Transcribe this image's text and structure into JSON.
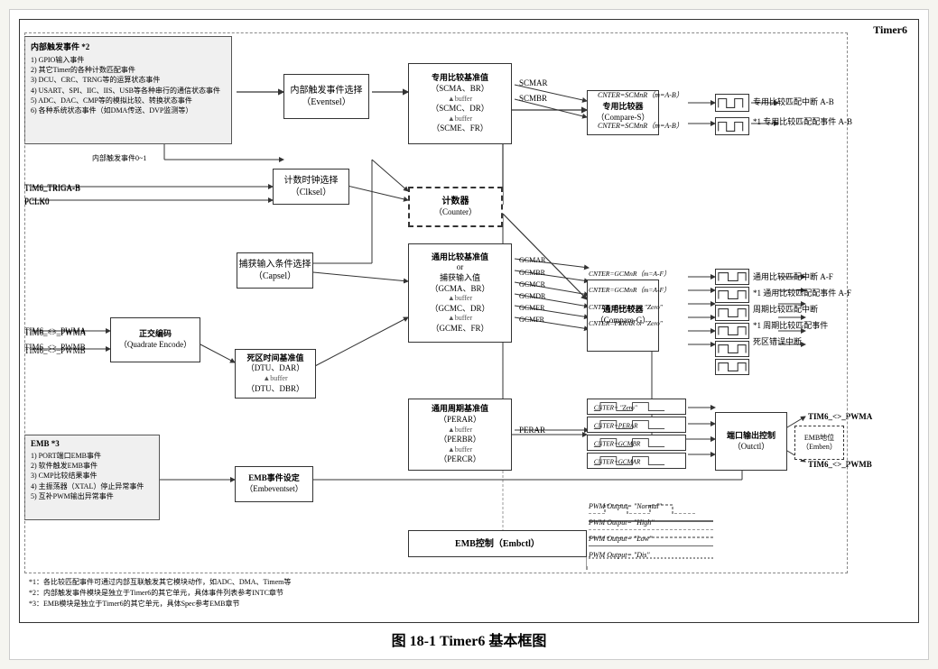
{
  "title": "Timer6",
  "caption": "图  18-1   Timer6 基本框图",
  "left_panel": {
    "header": "内部触发事件 *2",
    "items": [
      "1) GPIO输入事件",
      "2) 其它Timer的各种计数匹配事件",
      "3) DCU、CRC、TRNG等的运算状态事件",
      "4) USART、SPI、IIC、IIS、USB等各种串行的通信状态",
      "   事件",
      "5) ADC、DAC、CMP等的模拟比较、转换状态事件",
      "6) 各种系统状态事件（如DMA传送、DVP监测等）"
    ]
  },
  "emb_panel": {
    "header": "EMB *3",
    "items": [
      "1) PORT端口EMB事件",
      "2) 软件触发EMB事件",
      "3) CMP比较结果事件",
      "4) 主振荡器（XTAL）停止异常事件",
      "5) 互补PWM输出异常事件"
    ]
  },
  "boxes": {
    "eventsel": {
      "line1": "内部触发事件选择",
      "line2": "（Eventsel）"
    },
    "clksel": {
      "line1": "计数时钟选择",
      "line2": "（Clksel）"
    },
    "capsel": {
      "line1": "捕获输入条件选择",
      "line2": "（Capsel）"
    },
    "counter": {
      "line1": "计数器",
      "line2": "（Counter）"
    },
    "compare_s": {
      "line1": "专用比较器",
      "line2": "（Compare-S）"
    },
    "compare_g": {
      "line1": "通用比较器",
      "line2": "（Compare-G）"
    },
    "quadrate": {
      "line1": "正交编码",
      "line2": "（Quadrate Encode）"
    },
    "dead_ref": {
      "line1": "死区时间基准值",
      "line2": "（DTU、DAR）",
      "line3": "buffer",
      "line4": "（DTU、DBR）"
    },
    "special_ref": {
      "line1": "专用比较基准值",
      "line2": "（SCMA、BR）",
      "line3": "buffer",
      "line4": "（SCMC、DR）",
      "line5": "buffer",
      "line6": "（SCME、FR）"
    },
    "general_ref": {
      "line1": "通用比较基准值",
      "line2": "or",
      "line3": "捕获输入值",
      "line4": "（GCMA、BR）",
      "line5": "buffer",
      "line6": "（GCMC、DR）",
      "line7": "buffer",
      "line8": "（GCME、FR）"
    },
    "period_ref": {
      "line1": "通用周期基准值",
      "line2": "（PERAR）",
      "line3": "buffer",
      "line4": "（PERBR）",
      "line5": "buffer",
      "line6": "（PERCR）"
    },
    "embeventset": {
      "line1": "EMB事件设定",
      "line2": "（Embeventset）"
    },
    "outctl": {
      "line1": "端口输出控制",
      "line2": "（Outctl）"
    },
    "emb_label": {
      "line1": "EMB地位",
      "line2": "（Emben）"
    },
    "emb_control": {
      "line1": "EMB控制（Embctl）"
    }
  },
  "signals": {
    "tim6_triga_b": "TIM6_TRIGA-B",
    "pclk0": "PCLK0",
    "tim6_pwma": "TIM6_<>_PWMA",
    "tim6_pwmb": "TIM6_<>_PWMB",
    "tim6_pwma_out": "TIM6_<>_PWMA",
    "tim6_pwmb_out": "TIM6_<>_PWMB",
    "scmar": "SCMAR",
    "scmbr": "SCMBR",
    "perar": "PERAR",
    "gcmar": "GCMAR",
    "gcmbr": "GCMBR",
    "gcmcr": "GCMCR",
    "gcmdr": "GCMDR",
    "gcmer": "GCMER",
    "gcmfr": "GCMFR"
  },
  "outputs": {
    "special_int_ab": "专用比较匹配中断 A-B",
    "special_event_ab": "*1 专用比较匹配配事件 A-B",
    "general_int_af": "通用比较匹配中断 A-F",
    "general_event_af": "*1 通用比较匹配配事件 A-F",
    "period_int": "周期比较匹配中断",
    "period_event": "*1 周期比较匹配事件",
    "dead_err": "死区错误中断"
  },
  "wave_labels": {
    "cnter_scmnr_1": "CNTER=SCMnR（m=A-B）",
    "cnter_scmnr_2": "CNTER=SCMnR（m=A-B）",
    "cnter_gcmnr_1": "CNTER=GCMnR（m=A-F）",
    "cnter_gcmnr_2": "CNTER=GCMnR（m=A-F）",
    "cnter_zero_1": "CNTER= \"Zero\"",
    "cnter_perar": "CNTER=PERAR",
    "cnter_gcmbr": "CNTER=GCMBR",
    "cnter_gcmar": "CNTER=GCMAR",
    "cnter_perar2": "CNTER=PERAR or \"Zero\"",
    "cnter_perar3": "CNTER=PERAR or \"Zero\"",
    "pwm_normal": "PWM Output= \"Normal\"",
    "pwm_high": "PWM Output= \"High\"",
    "pwm_low": "PWM Output= \"Low\"",
    "pwm_dis": "PWM Output= \"Dis\""
  },
  "footnotes": [
    "*1：各比较匹配事件可通过内部互联触发其它模块动作，如ADC、DMA、Timem等",
    "*2：内部触发事件模块是独立于Timer6的其它单元，具体事件列表参考INTC章节",
    "*3：EMB模块是独立于Timer6的其它单元，具体Spec参考EMB章节"
  ]
}
